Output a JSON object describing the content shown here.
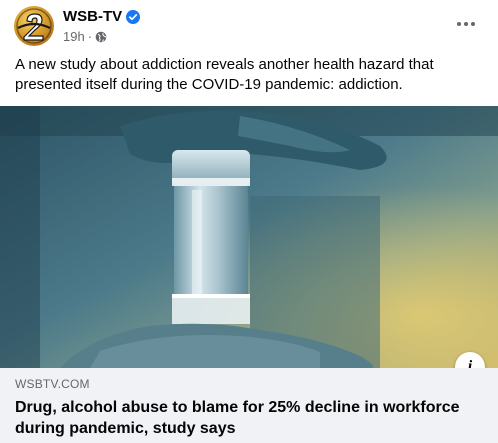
{
  "post": {
    "page_name": "WSB-TV",
    "timestamp": "19h",
    "separator": "·",
    "audience_icon": "globe-icon",
    "verified_icon": "verified-badge-icon",
    "more_icon": "more-options-icon",
    "text": "A new study about addiction reveals another health hazard that presented itself during the COVID-19 pandemic: addiction."
  },
  "link_preview": {
    "image_icon": "info-icon",
    "info_label": "i",
    "domain": "WSBTV.COM",
    "headline": "Drug, alcohol abuse to blame for 25% decline in workforce during pandemic, study says"
  },
  "colors": {
    "verified": "#1877f2",
    "meta_text": "#65676b",
    "footer_bg": "#f0f2f5",
    "image_tint": "#3d6878"
  }
}
